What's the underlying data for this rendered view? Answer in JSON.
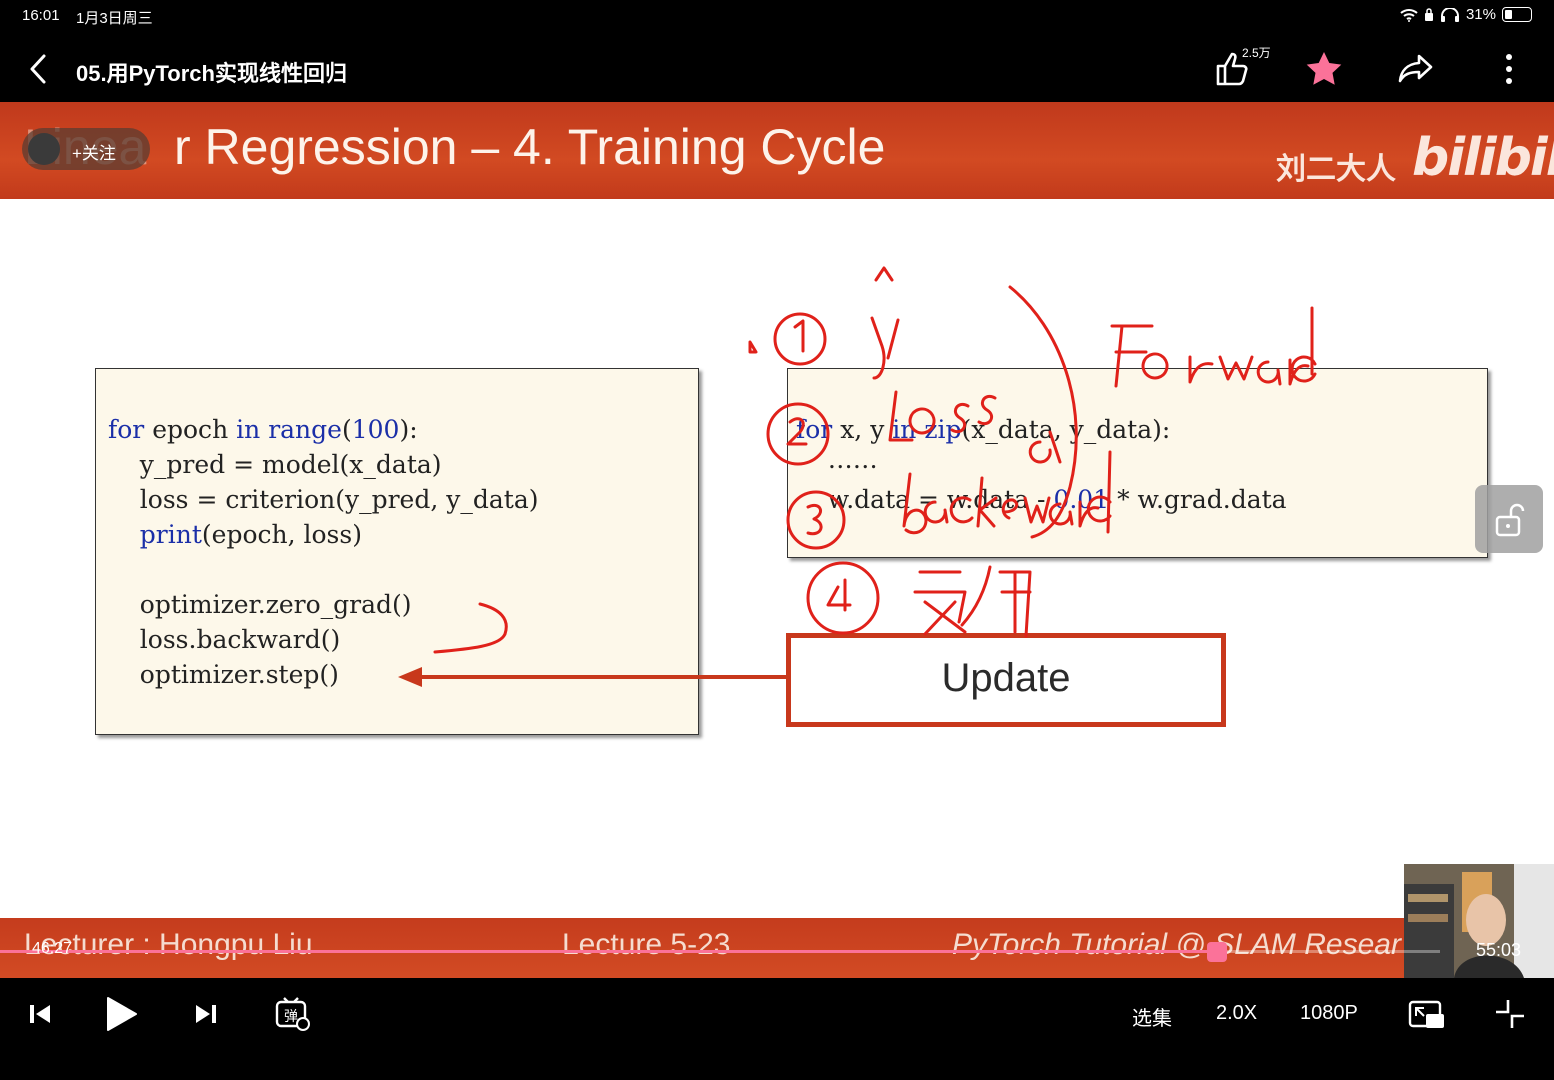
{
  "status": {
    "time": "16:01",
    "date": "1月3日周三",
    "battery": "31%"
  },
  "titlebar": {
    "back_icon": "chevron-left-icon",
    "title": "05.用PyTorch实现线性回归",
    "like_count": "2.5万"
  },
  "slide": {
    "title_fragment": "Linea",
    "title": "r Regression – 4. Training Cycle",
    "follow_label": "+关注",
    "author": "刘二大人",
    "logo": "bilibili",
    "code_left": [
      "for epoch in range(100):",
      "    y_pred = model(x_data)",
      "    loss = criterion(y_pred, y_data)",
      "    print(epoch, loss)",
      "",
      "    optimizer.zero_grad()",
      "    loss.backward()",
      "    optimizer.step()"
    ],
    "code_right": [
      "for x, y in zip(x_data, y_data):",
      "    ……",
      "    w.data = w.data - 0.01 * w.grad.data"
    ],
    "update_label": "Update",
    "annotations": {
      "forward": "Forward",
      "loss": "Loss",
      "backward": "backward",
      "update_cn": "更新",
      "yhat": "ŷ"
    },
    "footer": {
      "lecturer": "Lecturer : Hongpu Liu",
      "lecture": "Lecture 5-23",
      "tutorial": "PyTorch Tutorial @ SLAM Resear"
    },
    "colors": {
      "header": "#c8401e",
      "ink": "#e0211a",
      "code_bg": "#fdf8ea",
      "keyword": "#1b2fa8"
    }
  },
  "player": {
    "time_current": "46:27",
    "time_total": "55:03",
    "progress": 0.845,
    "episodes_label": "选集",
    "speed_label": "2.0X",
    "quality_label": "1080P"
  }
}
